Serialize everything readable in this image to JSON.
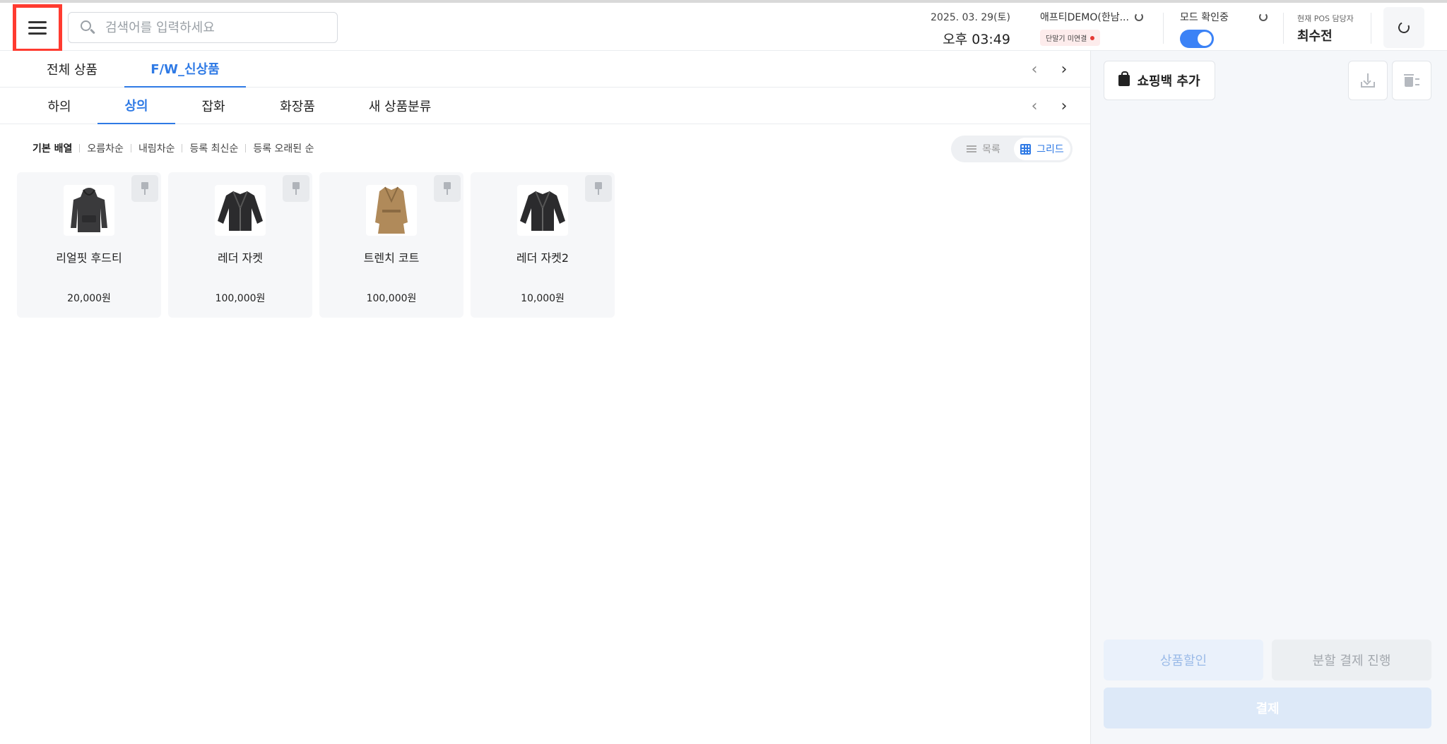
{
  "header": {
    "search_placeholder": "검색어를 입력하세요",
    "date": "2025. 03. 29(토)",
    "time": "오후 03:49",
    "store_name": "애프티DEMO(한남...",
    "terminal_status": "단말기 미연결",
    "mode_label": "모드 확인중",
    "mode_enabled": true,
    "manager_label": "현재 POS 담당자",
    "manager_name": "최수전"
  },
  "category_tabs": [
    {
      "label": "전체 상품",
      "active": false
    },
    {
      "label": "F/W_신상품",
      "active": true
    }
  ],
  "sub_tabs": [
    {
      "label": "하의",
      "active": false
    },
    {
      "label": "상의",
      "active": true
    },
    {
      "label": "잡화",
      "active": false
    },
    {
      "label": "화장품",
      "active": false
    },
    {
      "label": "새 상품분류",
      "active": false
    }
  ],
  "sort_options": [
    "기본 배열",
    "오름차순",
    "내림차순",
    "등록 최신순",
    "등록 오래된 순"
  ],
  "sort_active": "기본 배열",
  "view_toggle": {
    "list_label": "목록",
    "grid_label": "그리드",
    "selected": "grid"
  },
  "products": [
    {
      "name": "리얼핏 후드티",
      "price": "20,000원",
      "image": "hoodie"
    },
    {
      "name": "레더 자켓",
      "price": "100,000원",
      "image": "leather-jacket"
    },
    {
      "name": "트렌치 코트",
      "price": "100,000원",
      "image": "trench-coat"
    },
    {
      "name": "레더 자켓2",
      "price": "10,000원",
      "image": "leather-jacket"
    }
  ],
  "right_panel": {
    "shopping_bag_label": "쇼핑백 추가",
    "discount_label": "상품할인",
    "split_payment_label": "분할 결제 진행",
    "pay_label": "결제"
  },
  "colors": {
    "accent": "#2f7ae5",
    "highlight_border": "#ff3b30",
    "status_dot": "#e53935"
  }
}
